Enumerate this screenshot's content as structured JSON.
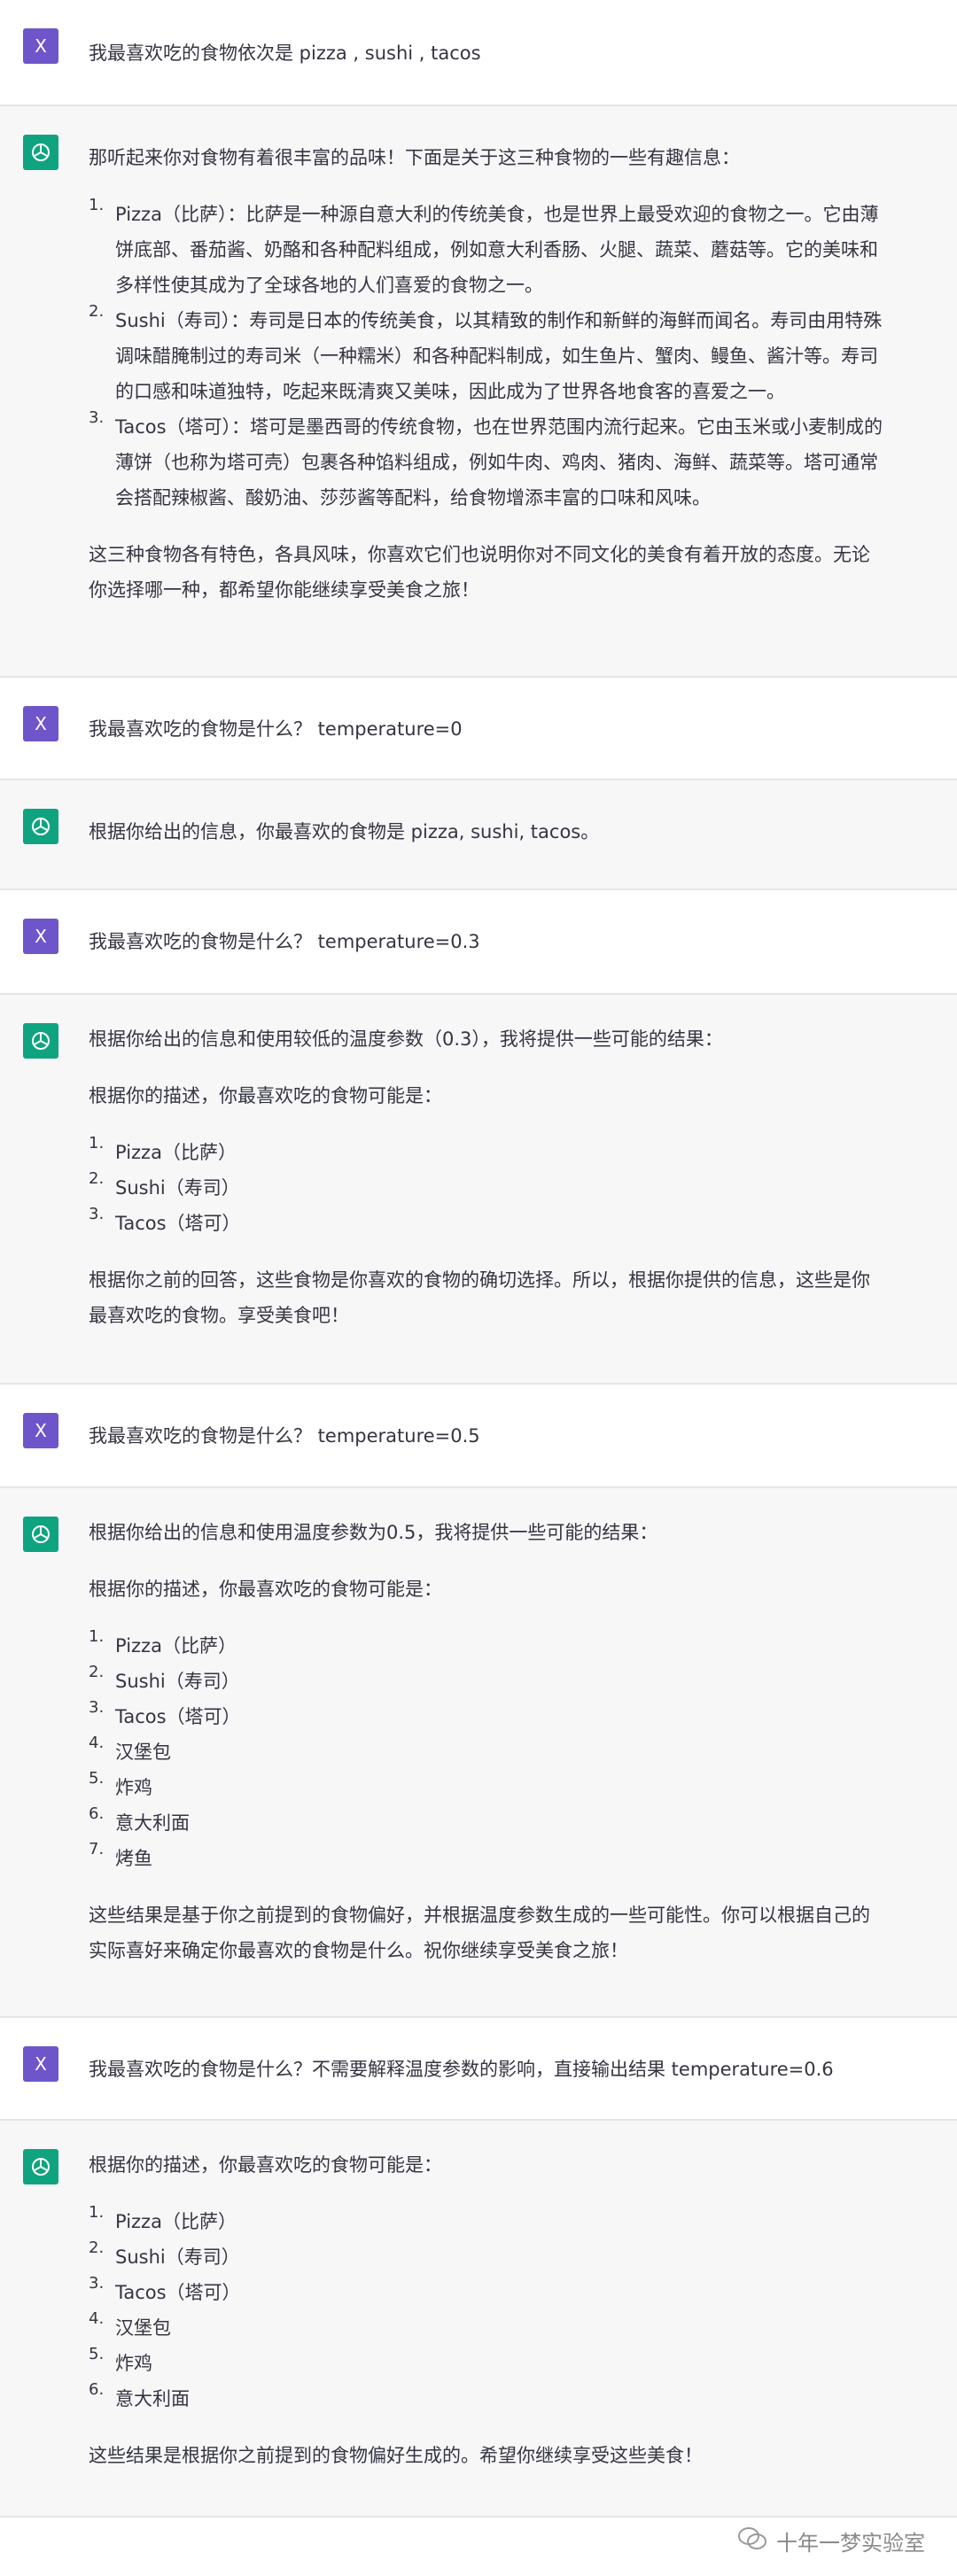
{
  "avatars": {
    "user_letter": "X",
    "assistant_icon": "openai-logo-icon",
    "user_color": "#6e55c9",
    "assistant_color": "#10a37f"
  },
  "messages": [
    {
      "role": "user",
      "text": "我最喜欢吃的食物依次是 pizza , sushi , tacos"
    },
    {
      "role": "assistant",
      "intro": "那听起来你对食物有着很丰富的品味！下面是关于这三种食物的一些有趣信息：",
      "items": [
        "Pizza（比萨）：比萨是一种源自意大利的传统美食，也是世界上最受欢迎的食物之一。它由薄饼底部、番茄酱、奶酪和各种配料组成，例如意大利香肠、火腿、蔬菜、蘑菇等。它的美味和多样性使其成为了全球各地的人们喜爱的食物之一。",
        "Sushi（寿司）：寿司是日本的传统美食，以其精致的制作和新鲜的海鲜而闻名。寿司由用特殊调味醋腌制过的寿司米（一种糯米）和各种配料制成，如生鱼片、蟹肉、鳗鱼、酱汁等。寿司的口感和味道独特，吃起来既清爽又美味，因此成为了世界各地食客的喜爱之一。",
        "Tacos（塔可）：塔可是墨西哥的传统食物，也在世界范围内流行起来。它由玉米或小麦制成的薄饼（也称为塔可壳）包裹各种馅料组成，例如牛肉、鸡肉、猪肉、海鲜、蔬菜等。塔可通常会搭配辣椒酱、酸奶油、莎莎酱等配料，给食物增添丰富的口味和风味。"
      ],
      "outro": "这三种食物各有特色，各具风味，你喜欢它们也说明你对不同文化的美食有着开放的态度。无论你选择哪一种，都希望你能继续享受美食之旅！"
    },
    {
      "role": "user",
      "text": "我最喜欢吃的食物是什么？ temperature=0"
    },
    {
      "role": "assistant",
      "intro": "根据你给出的信息，你最喜欢的食物是 pizza, sushi, tacos。"
    },
    {
      "role": "user",
      "text": "我最喜欢吃的食物是什么？ temperature=0.3"
    },
    {
      "role": "assistant",
      "intro": "根据你给出的信息和使用较低的温度参数（0.3），我将提供一些可能的结果：",
      "intro2": "根据你的描述，你最喜欢吃的食物可能是：",
      "items": [
        "Pizza（比萨）",
        "Sushi（寿司）",
        "Tacos（塔可）"
      ],
      "outro": "根据你之前的回答，这些食物是你喜欢的食物的确切选择。所以，根据你提供的信息，这些是你最喜欢吃的食物。享受美食吧！"
    },
    {
      "role": "user",
      "text": "我最喜欢吃的食物是什么？ temperature=0.5"
    },
    {
      "role": "assistant",
      "intro": "根据你给出的信息和使用温度参数为0.5，我将提供一些可能的结果：",
      "intro2": "根据你的描述，你最喜欢吃的食物可能是：",
      "items": [
        "Pizza（比萨）",
        "Sushi（寿司）",
        "Tacos（塔可）",
        "汉堡包",
        "炸鸡",
        "意大利面",
        "烤鱼"
      ],
      "outro": "这些结果是基于你之前提到的食物偏好，并根据温度参数生成的一些可能性。你可以根据自己的实际喜好来确定你最喜欢的食物是什么。祝你继续享受美食之旅！"
    },
    {
      "role": "user",
      "text": "我最喜欢吃的食物是什么？不需要解释温度参数的影响，直接输出结果 temperature=0.6"
    },
    {
      "role": "assistant",
      "intro": "根据你的描述，你最喜欢吃的食物可能是：",
      "items": [
        "Pizza（比萨）",
        "Sushi（寿司）",
        "Tacos（塔可）",
        "汉堡包",
        "炸鸡",
        "意大利面"
      ],
      "outro": "这些结果是根据你之前提到的食物偏好生成的。希望你继续享受这些美食！"
    }
  ],
  "watermark": {
    "icon": "wechat-icon",
    "text": "十年一梦实验室"
  }
}
